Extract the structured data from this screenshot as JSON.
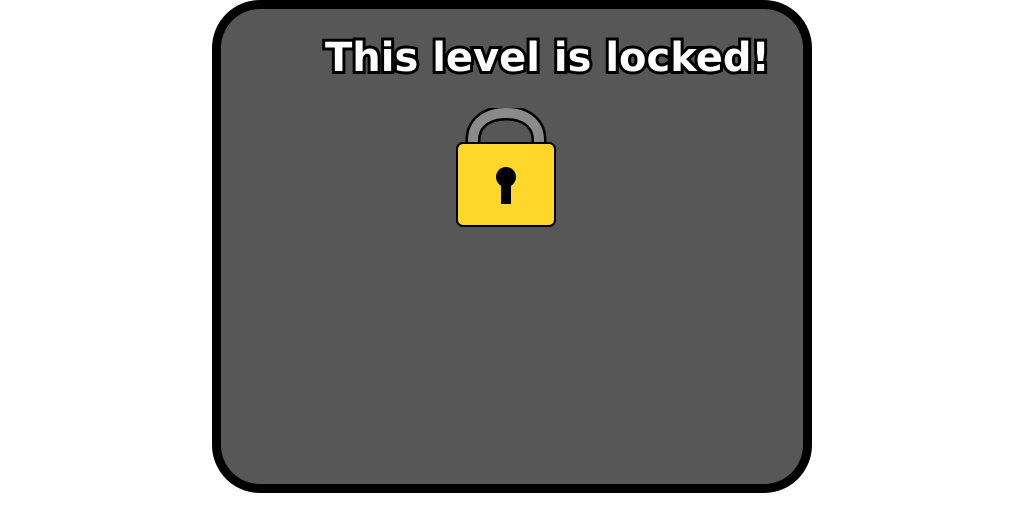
{
  "screen": {
    "background_color": "#ffffff"
  },
  "panel": {
    "fill_color": "#575757",
    "border_color": "#000000"
  },
  "lock_message": {
    "title": "This level is locked!",
    "text_color": "#ffffff",
    "outline_color": "#000000"
  },
  "lock_icon": {
    "name": "padlock-icon",
    "body_color": "#ffd62a",
    "shackle_color": "#8a8a8a",
    "keyhole_color": "#000000"
  }
}
